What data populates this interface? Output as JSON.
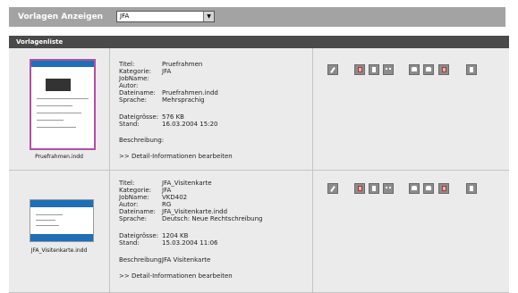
{
  "toolbar": {
    "label": "Vorlagen Anzeigen",
    "select_value": "JFA"
  },
  "list": {
    "title": "Vorlagenliste"
  },
  "templates": [
    {
      "thumbnail_caption": "Pruefrahmen.indd",
      "fields": [
        {
          "label": "Titel:",
          "value": "Pruefrahmen"
        },
        {
          "label": "Kategorie:",
          "value": "JFA"
        },
        {
          "label": "JobName:",
          "value": ""
        },
        {
          "label": "Autor:",
          "value": ""
        },
        {
          "label": "Dateiname:",
          "value": "Pruefrahmen.indd"
        },
        {
          "label": "Sprache:",
          "value": "Mehrsprachig"
        }
      ],
      "size": {
        "label": "Dateigrösse:",
        "value": "576 KB"
      },
      "stand": {
        "label": "Stand:",
        "value": "16.03.2004 15:20"
      },
      "description": {
        "label": "Beschreibung:",
        "value": ""
      },
      "edit_link": ">> Detail-Informationen bearbeiten"
    },
    {
      "thumbnail_caption": "JFA_Visitenkarte.indd",
      "fields": [
        {
          "label": "Titel:",
          "value": "JFA_Visitenkarte"
        },
        {
          "label": "Kategorie:",
          "value": "JFA"
        },
        {
          "label": "JobName:",
          "value": "VKD402"
        },
        {
          "label": "Autor:",
          "value": "RG"
        },
        {
          "label": "Dateiname:",
          "value": "JFA_Visitenkarte.indd"
        },
        {
          "label": "Sprache:",
          "value": "Deutsch: Neue Rechtschreibung"
        }
      ],
      "size": {
        "label": "Dateigrösse:",
        "value": "1204 KB"
      },
      "stand": {
        "label": "Stand:",
        "value": "15.03.2004 11:06"
      },
      "description": {
        "label": "Beschreibung:",
        "value": "JFA Visitenkarte"
      },
      "edit_link": ">> Detail-Informationen bearbeiten"
    }
  ],
  "action_icons": [
    "edit-icon",
    "document-icon",
    "export-icon",
    "dots-icon",
    "print-icon",
    "stamp-icon",
    "pdf-icon",
    "delete-icon"
  ]
}
